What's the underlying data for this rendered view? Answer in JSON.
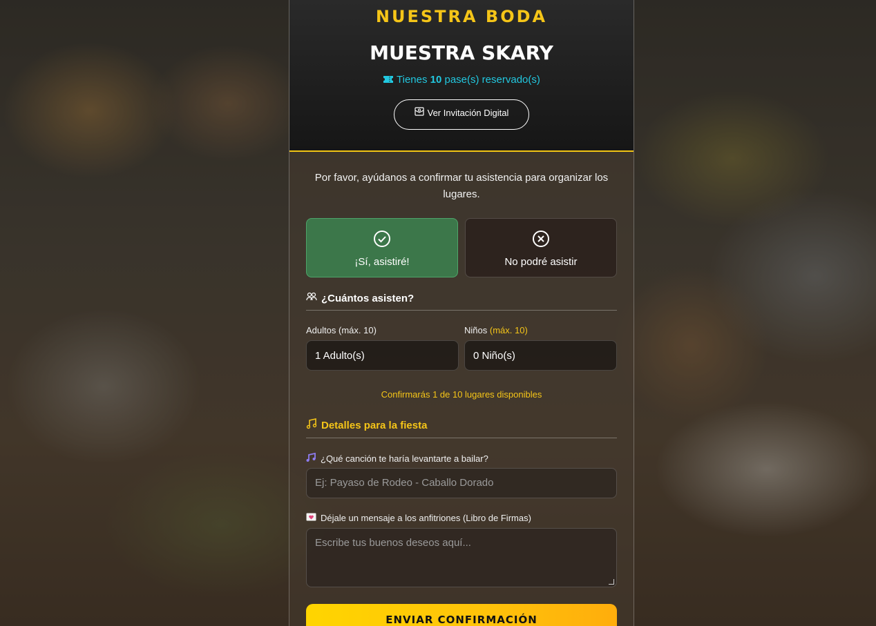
{
  "header": {
    "kicker": "NUESTRA BODA",
    "guest_name": "MUESTRA SKARY",
    "passes_prefix": "Tienes",
    "passes_count": "10",
    "passes_suffix": "pase(s) reservado(s)",
    "invite_button": "Ver Invitación Digital"
  },
  "form": {
    "intro": "Por favor, ayúdanos a confirmar tu asistencia para organizar los lugares.",
    "choices": {
      "yes": "¡Sí, asistiré!",
      "no": "No podré asistir"
    },
    "attendance": {
      "title": "¿Cuántos asisten?",
      "adults_label": "Adultos",
      "adults_max": "(máx. 10)",
      "children_label": "Niños",
      "children_max": "(máx. 10)",
      "adults_value": "1 Adulto(s)",
      "children_value": "0 Niño(s)",
      "confirm_note": "Confirmarás 1 de 10 lugares disponibles"
    },
    "party": {
      "title": "Detalles para la fiesta",
      "song_label": "¿Qué canción te haría levantarte a bailar?",
      "song_placeholder": "Ej: Payaso de Rodeo - Caballo Dorado",
      "message_label": "Déjale un mensaje a los anfitriones (Libro de Firmas)",
      "message_placeholder": "Escribe tus buenos deseos aquí..."
    },
    "submit": "ENVIAR CONFIRMACIÓN"
  },
  "colors": {
    "accent": "#f5c518",
    "passes": "#22c8e0",
    "yes_bg": "#3c8250"
  }
}
